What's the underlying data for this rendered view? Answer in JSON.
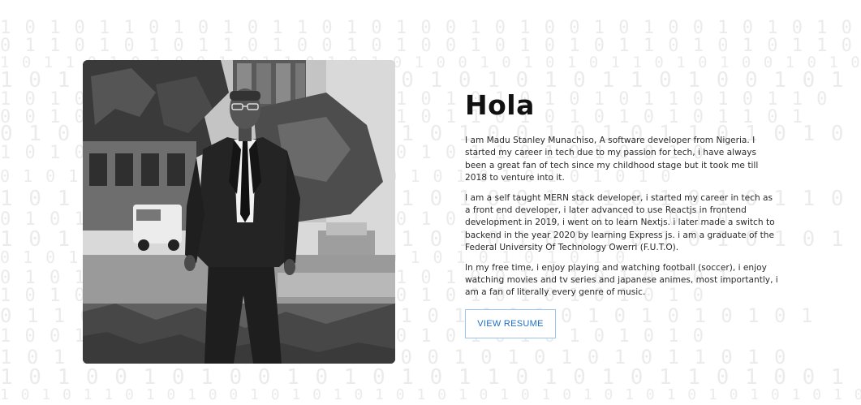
{
  "background": {
    "rows": [
      "1 0 1 0 1 1 0 1 0 1 0 1 1 0 1 0 1 0 0 1 0 1 0 0 1 0 1 0 0 1 0 1 0 1 0 1 1 0 1 0 1 0 1 1 0 1 0 0 1 0 1 0 0 1 0",
      "0 1 1 0 1 0 1 0 1 1 0 1 0 0 1 0 1 0 0 1 0 1 0 1 0 1 1 0 1 0 1 0 1 1 0 1 0 0 1 0 1 0 0 1 0 1 0 1 0 1 1 0 1",
      "1 0 1 1 0 1 0 1 0 0 1 0 1 1 0 1 0 1 0 1 0 0 1 0 1 0 1 0 1 1 0 1 0 1 0 0 1 0 1 0 1 0 1 0 1 0 0 1 0 1 0 1",
      "1 0 1 1 0      1 0 1 1 0 1 0 1 0 0 1 0 1 0 1 0 1 1 0 1 0 0 1 0 1 0 1 0 1 1 0 1",
      "1 0 1 0 0      0 0 1 0 1 0 1 0 1 0 1 1 0 1 0 1 0 1 0 1 0 1 1 0 1 0 1 1 0",
      "0 0 1 0 1      1 0 1 0 1 0 0 1 0 1 0 1 0 1 1 0 1 0 1 0 1 0 1 0 1 1 0 1",
      "0 1 0 1 0      1 0 1 0 0 1 0 1 0 1 0 1 0 0 1 0 1 0 1 1 0 1 0 1 0 1",
      "1 0 1 0 0      0 1 0 1 1 0 1 0 1 0 1 0 1 0 1 1 0 1 0 1 0 0 1 0",
      "0 1 0 1 0      1 0 1 0 1 0 1 0 0 1 0 1 0 1 0 1 0 1 0 1 0 1 0 1 0",
      "1 0 1 1 0      1 0 1 0 1 1 0 1 0 1 0 1 0 0 1 0 1 0 1 0 1 0 1 1 0 1",
      "0 1 0 1 0      1 1 0 1 0 1 0 1 0 1 0 0 1 0 1 0 1 0 1 1 0 1 0 1 0",
      "1 0 1 0 0      1 1 0 1 0 1 0 1 0 1 0 1 0 1 0 0 1 0 1 0 1 0 1 0 1 0 0",
      "0 1 0 1 0      1 0 1 0 1 1 0 1 0 1 0 1 0 1 0 1 0 1 0 1 0 1 0",
      "0 1 0 1 0      1 0 1 0 1 0 1 0 1 1 0 1 0 1 0 0 1 0 1 0 1 0 1 0 1",
      "1 0 1 0 1      0 1 0 1 0 1 0 0 1 0 1 0 1 0 1 0 1 0 1 0 1 0 1 0",
      "0 1 1 0 1      1 0 1 0 1 0 1 0 1 0 1 0 1 0 0 1 0 1 0 1 0 1 0 1 0 1",
      "1 0 0 1 0      0 1 0 1 0 1 0 0 1 0 1 0 1 0 1 0 1 0 1 0 1 0 1 0",
      "1 0 1 1 0      0 1 0 1 0 1 0 1 0 1 0 0 1 0 1 0 1 0 1 0 1 1 0 1 0",
      "1 0 1 0 0 1 0 1 0 0 1 0 1 0 1 0 1 1 0 1 0 1 0 1 1 0 1 0 0 1 0 1 0 0 1 0 1 0 1 0 1 0 1 0 1 0 1",
      "1 0 1 0 1 1 0 1 0 1 0 0 1 0 1 0 1 0 1 0 1 0 1 0 1 0 1 0 1 0 1 0 1 0 1 0 1 0 1 0 1 0 1 0 1"
    ]
  },
  "about": {
    "heading": "Hola",
    "paragraphs": [
      "I am Madu Stanley Munachiso, A software developer from Nigeria. I started my career in tech due to my passion for tech, i have always been a great fan of tech since my childhood stage but it took me till 2018 to venture into it.",
      "I am a self taught MERN stack developer, i started my career in tech as a front end developer, i later advanced to use Reactjs in frontend development in 2019, i went on to learn Nextjs. i later made a switch to backend in the year 2020 by learning Express js. i am a graduate of the Federal University Of Technology Owerri (F.U.T.O).",
      "In my free time, i enjoy playing and watching football (soccer), i enjoy watching movies and tv series and japanese animes, most importantly, i am a fan of literally every genre of music."
    ],
    "resume_label": "VIEW RESUME",
    "accent_color": "#1d6fc7"
  }
}
